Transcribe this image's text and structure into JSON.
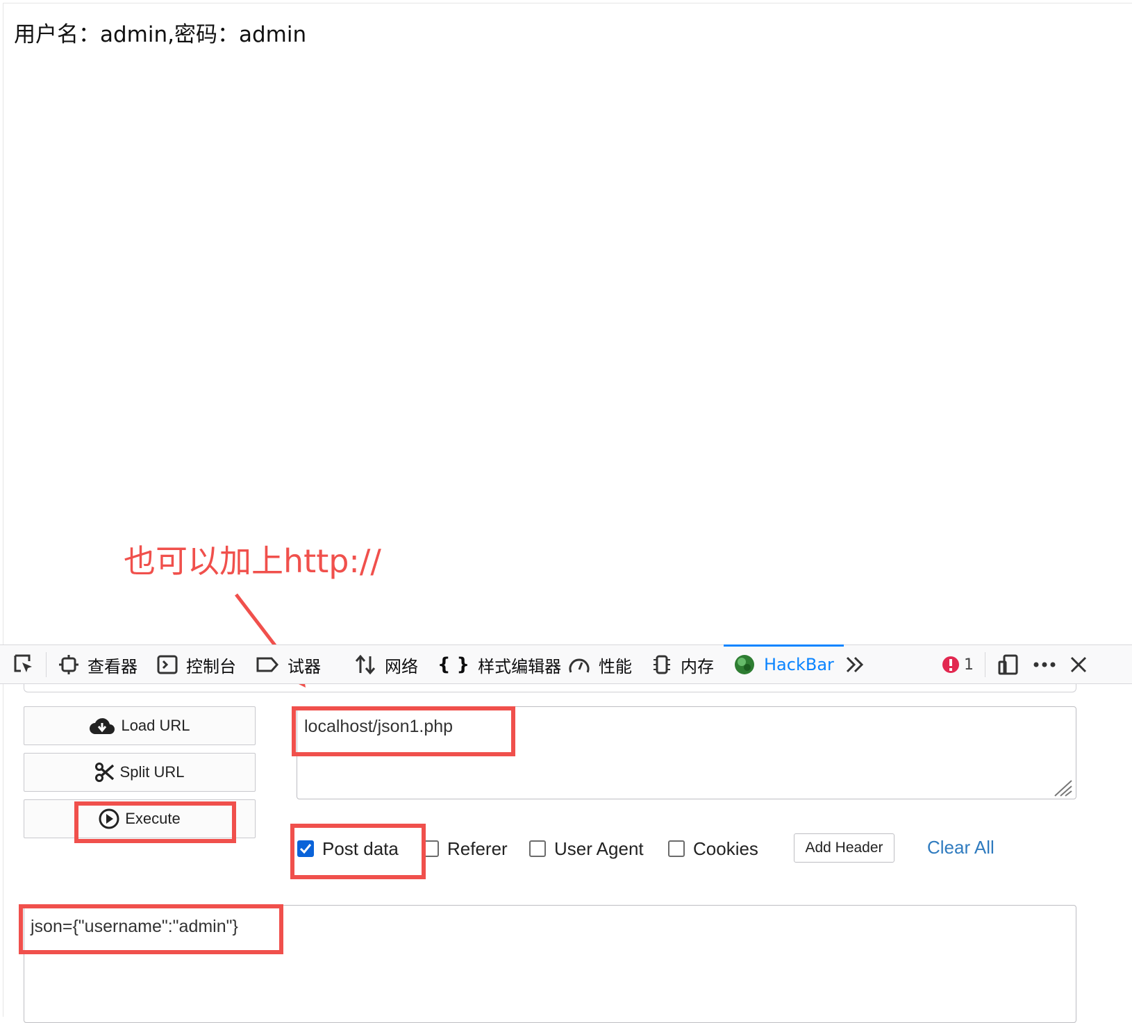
{
  "page": {
    "content_text": "用户名：admin,密码：admin"
  },
  "annotation": {
    "text": "也可以加上http://",
    "color": "#f0504c"
  },
  "devtools": {
    "tabs": [
      {
        "label": "查看器",
        "icon": "inspector-icon"
      },
      {
        "label": "控制台",
        "icon": "console-icon"
      },
      {
        "label": "试器",
        "icon": "debugger-icon"
      },
      {
        "label": "网络",
        "icon": "network-icon"
      },
      {
        "label": "样式编辑器",
        "icon": "style-editor-icon"
      },
      {
        "label": "性能",
        "icon": "performance-icon"
      },
      {
        "label": "内存",
        "icon": "memory-icon"
      },
      {
        "label": "HackBar",
        "icon": "hackbar-icon",
        "active": true
      }
    ],
    "error_count": "1",
    "accent": "#0a84ff"
  },
  "hackbar": {
    "buttons": {
      "load_url": "Load URL",
      "split_url": "Split URL",
      "execute": "Execute"
    },
    "url_value": "localhost/json1.php",
    "options": {
      "post_data": {
        "label": "Post data",
        "checked": true
      },
      "referer": {
        "label": "Referer",
        "checked": false
      },
      "user_agent": {
        "label": "User Agent",
        "checked": false
      },
      "cookies": {
        "label": "Cookies",
        "checked": false
      }
    },
    "add_header": "Add Header",
    "clear_all": "Clear All",
    "post_body": "json={\"username\":\"admin\"}"
  }
}
